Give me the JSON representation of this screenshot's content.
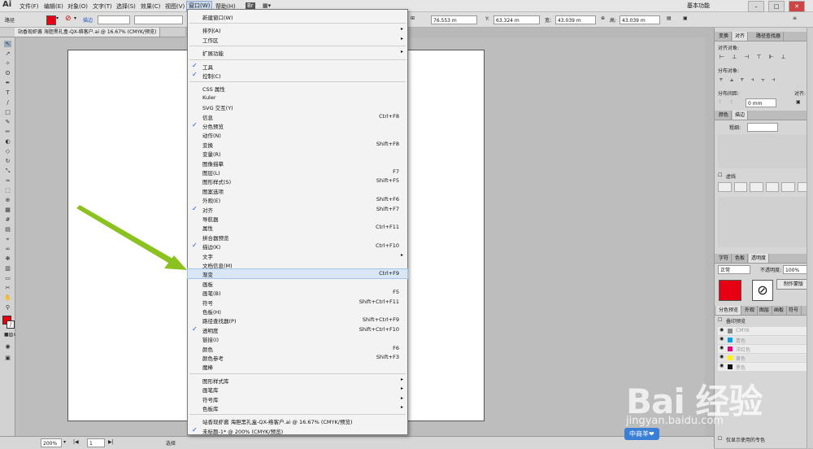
{
  "menubar": {
    "logo": "Ai",
    "items": [
      "文件(F)",
      "编辑(E)",
      "对象(O)",
      "文字(T)",
      "选择(S)",
      "效果(C)",
      "视图(V)",
      "窗口(W)",
      "帮助(H)"
    ],
    "workspace": "基本功能"
  },
  "control": {
    "label_path": "路径",
    "label_stroke": "描边",
    "x": "76.553 m",
    "y": "63.324 m",
    "w": "43.039 m",
    "h": "43.039 m"
  },
  "document_tab": "站香现虾酱 海胆黑礼盒-QX-络客户.ai @ 16.67% (CMYK/预览)",
  "status": {
    "zoom": "200%",
    "page": "1",
    "mode": "选择"
  },
  "window_menu": {
    "items": [
      {
        "label": "新建窗口(W)",
        "checked": false,
        "shortcut": "",
        "submenu": false,
        "highlight": false
      },
      {
        "sep": true
      },
      {
        "label": "排列(A)",
        "checked": false,
        "shortcut": "",
        "submenu": true,
        "highlight": false
      },
      {
        "label": "工作区",
        "checked": false,
        "shortcut": "",
        "submenu": true,
        "highlight": false
      },
      {
        "sep": true
      },
      {
        "label": "扩展功能",
        "checked": false,
        "shortcut": "",
        "submenu": true,
        "highlight": false
      },
      {
        "sep": true
      },
      {
        "label": "工具",
        "checked": true,
        "shortcut": "",
        "submenu": false,
        "highlight": false
      },
      {
        "label": "控制(C)",
        "checked": true,
        "shortcut": "",
        "submenu": false,
        "highlight": false
      },
      {
        "sep": true
      },
      {
        "label": "CSS 属性",
        "checked": false,
        "shortcut": "",
        "submenu": false,
        "highlight": false
      },
      {
        "label": "Kuler",
        "checked": false,
        "shortcut": "",
        "submenu": false,
        "highlight": false
      },
      {
        "label": "SVG 交互(Y)",
        "checked": false,
        "shortcut": "",
        "submenu": false,
        "highlight": false
      },
      {
        "label": "信息",
        "checked": false,
        "shortcut": "Ctrl+F8",
        "submenu": false,
        "highlight": false
      },
      {
        "label": "分色预览",
        "checked": true,
        "shortcut": "",
        "submenu": false,
        "highlight": false
      },
      {
        "label": "动作(N)",
        "checked": false,
        "shortcut": "",
        "submenu": false,
        "highlight": false
      },
      {
        "label": "变换",
        "checked": false,
        "shortcut": "Shift+F8",
        "submenu": false,
        "highlight": false
      },
      {
        "label": "变量(R)",
        "checked": false,
        "shortcut": "",
        "submenu": false,
        "highlight": false
      },
      {
        "label": "图像描摹",
        "checked": false,
        "shortcut": "",
        "submenu": false,
        "highlight": false
      },
      {
        "label": "图层(L)",
        "checked": false,
        "shortcut": "F7",
        "submenu": false,
        "highlight": false
      },
      {
        "label": "图形样式(S)",
        "checked": false,
        "shortcut": "Shift+F5",
        "submenu": false,
        "highlight": false
      },
      {
        "label": "图案选项",
        "checked": false,
        "shortcut": "",
        "submenu": false,
        "highlight": false
      },
      {
        "label": "外观(E)",
        "checked": false,
        "shortcut": "Shift+F6",
        "submenu": false,
        "highlight": false
      },
      {
        "label": "对齐",
        "checked": true,
        "shortcut": "Shift+F7",
        "submenu": false,
        "highlight": false
      },
      {
        "label": "导航器",
        "checked": false,
        "shortcut": "",
        "submenu": false,
        "highlight": false
      },
      {
        "label": "属性",
        "checked": false,
        "shortcut": "Ctrl+F11",
        "submenu": false,
        "highlight": false
      },
      {
        "label": "拼合器预览",
        "checked": false,
        "shortcut": "",
        "submenu": false,
        "highlight": false
      },
      {
        "label": "描边(K)",
        "checked": true,
        "shortcut": "Ctrl+F10",
        "submenu": false,
        "highlight": false
      },
      {
        "label": "文字",
        "checked": false,
        "shortcut": "",
        "submenu": true,
        "highlight": false
      },
      {
        "label": "文档信息(M)",
        "checked": false,
        "shortcut": "",
        "submenu": false,
        "highlight": false
      },
      {
        "label": "渐变",
        "checked": false,
        "shortcut": "Ctrl+F9",
        "submenu": false,
        "highlight": true
      },
      {
        "label": "画板",
        "checked": false,
        "shortcut": "",
        "submenu": false,
        "highlight": false
      },
      {
        "label": "画笔(B)",
        "checked": false,
        "shortcut": "F5",
        "submenu": false,
        "highlight": false
      },
      {
        "label": "符号",
        "checked": false,
        "shortcut": "Shift+Ctrl+F11",
        "submenu": false,
        "highlight": false
      },
      {
        "label": "色板(H)",
        "checked": false,
        "shortcut": "",
        "submenu": false,
        "highlight": false
      },
      {
        "label": "路径查找器(P)",
        "checked": false,
        "shortcut": "Shift+Ctrl+F9",
        "submenu": false,
        "highlight": false
      },
      {
        "label": "透明度",
        "checked": true,
        "shortcut": "Shift+Ctrl+F10",
        "submenu": false,
        "highlight": false
      },
      {
        "label": "链接(I)",
        "checked": false,
        "shortcut": "",
        "submenu": false,
        "highlight": false
      },
      {
        "label": "颜色",
        "checked": false,
        "shortcut": "F6",
        "submenu": false,
        "highlight": false
      },
      {
        "label": "颜色参考",
        "checked": false,
        "shortcut": "Shift+F3",
        "submenu": false,
        "highlight": false
      },
      {
        "label": "魔棒",
        "checked": false,
        "shortcut": "",
        "submenu": false,
        "highlight": false
      },
      {
        "sep": true
      },
      {
        "label": "图形样式库",
        "checked": false,
        "shortcut": "",
        "submenu": true,
        "highlight": false
      },
      {
        "label": "画笔库",
        "checked": false,
        "shortcut": "",
        "submenu": true,
        "highlight": false
      },
      {
        "label": "符号库",
        "checked": false,
        "shortcut": "",
        "submenu": true,
        "highlight": false
      },
      {
        "label": "色板库",
        "checked": false,
        "shortcut": "",
        "submenu": true,
        "highlight": false
      },
      {
        "sep": true
      },
      {
        "label": "站香现虾酱 海胆黑礼盒-QX-络客户.ai @ 16.67% (CMYK/预览)",
        "checked": false,
        "shortcut": "",
        "submenu": false,
        "highlight": false
      },
      {
        "label": "未标题-1* @ 200% (CMYK/预览)",
        "checked": true,
        "shortcut": "",
        "submenu": false,
        "highlight": false
      }
    ]
  },
  "panels": {
    "align_tabs": [
      "变换",
      "对齐",
      "路径查找器"
    ],
    "align_objects": "对齐对象:",
    "distribute_objects": "分布对象:",
    "distribute_spacing": "分布间距:",
    "align_to": "对齐:",
    "spacing_value": "0 mm",
    "stroke_tabs": [
      "颜色",
      "描边"
    ],
    "weight_label": "粗细:",
    "dashed_label": "虚线",
    "transp_tabs": [
      "字符",
      "色板",
      "透明度"
    ],
    "blend_mode": "正常",
    "opacity_label": "不透明度:",
    "opacity_value": "100%",
    "make_mask": "制作蒙版",
    "sep_tabs": [
      "分色预览",
      "外观",
      "图层",
      "画板",
      "符号"
    ],
    "overprint_label": "叠印预览",
    "plates": [
      {
        "name": "CMYK",
        "color": "#888888"
      },
      {
        "name": "青色",
        "color": "#00a0e9"
      },
      {
        "name": "洋红色",
        "color": "#e4007f"
      },
      {
        "name": "黄色",
        "color": "#fff100"
      },
      {
        "name": "黑色",
        "color": "#111111"
      }
    ],
    "show_used": "仅显示使用的专色"
  },
  "watermark": {
    "logo": "Bai 经验",
    "url": "jingyan.baidu.com",
    "badge": "中商羊❤"
  },
  "colors": {
    "fill": "#e60012",
    "arrow": "#8cc21f",
    "menu_highlight": "#d8e6f6"
  }
}
